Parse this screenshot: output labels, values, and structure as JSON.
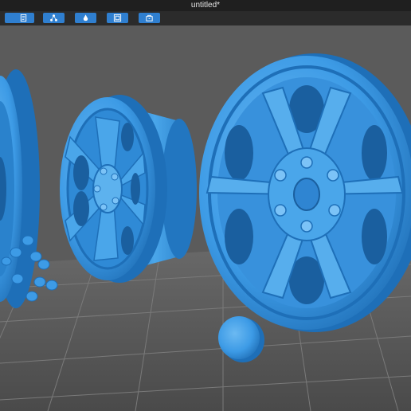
{
  "window": {
    "title": "untitled*"
  },
  "toolbar": {
    "buttons": [
      {
        "icon": "arrow-icon"
      },
      {
        "icon": "document-icon"
      },
      {
        "icon": "network-icon"
      },
      {
        "icon": "bucket-icon"
      },
      {
        "icon": "frame-icon"
      },
      {
        "icon": "layers-icon"
      }
    ]
  },
  "viewport": {
    "background": "#5a5a5a",
    "floor_color": "#4e4e4e",
    "grid_color": "#777777",
    "model_color": "#3d9be6",
    "model_dark": "#1e6fb8",
    "model_light": "#7cc3f7"
  }
}
